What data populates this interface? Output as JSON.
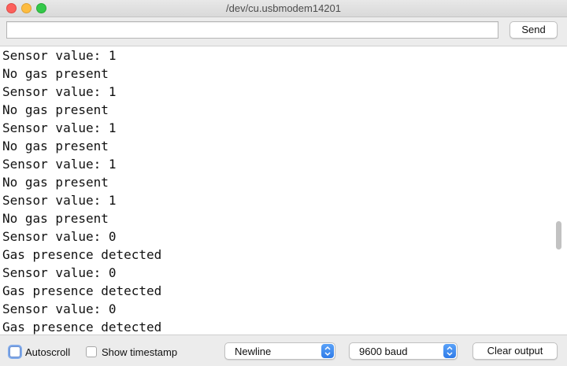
{
  "window": {
    "title": "/dev/cu.usbmodem14201"
  },
  "toolbar": {
    "input_value": "",
    "send_label": "Send"
  },
  "output": {
    "lines": [
      "Sensor value: 1",
      "No gas present",
      "Sensor value: 1",
      "No gas present",
      "Sensor value: 1",
      "No gas present",
      "Sensor value: 1",
      "No gas present",
      "Sensor value: 1",
      "No gas present",
      "Sensor value: 0",
      "Gas presence detected",
      "Sensor value: 0",
      "Gas presence detected",
      "Sensor value: 0",
      "Gas presence detected"
    ]
  },
  "footer": {
    "autoscroll_label": "Autoscroll",
    "autoscroll_checked": false,
    "timestamp_label": "Show timestamp",
    "timestamp_checked": false,
    "line_ending": "Newline",
    "baud_rate": "9600 baud",
    "clear_label": "Clear output"
  },
  "colors": {
    "close": "#fc605c",
    "minimize": "#fdbc40",
    "maximize": "#34c84a",
    "select_accent": "#2f7be8",
    "focus_ring": "#7fa9ea"
  }
}
